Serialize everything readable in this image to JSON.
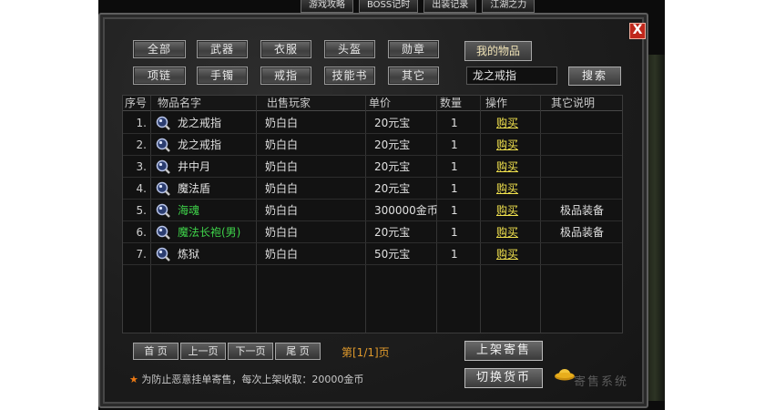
{
  "top_tabs": [
    "游戏攻略",
    "BOSS记时",
    "出装记录",
    "江湖之力"
  ],
  "close_label": "X",
  "categories_row1": [
    "全部",
    "武器",
    "衣服",
    "头盔",
    "勋章"
  ],
  "categories_row2": [
    "项链",
    "手镯",
    "戒指",
    "技能书",
    "其它"
  ],
  "my_items_label": "我的物品",
  "search": {
    "value": "龙之戒指",
    "button": "搜索"
  },
  "table": {
    "columns": [
      "序号",
      "物品名字",
      "出售玩家",
      "单价",
      "数量",
      "操作",
      "其它说明"
    ],
    "rows": [
      {
        "no": "1.",
        "name": "龙之戒指",
        "seller": "奶白白",
        "price": "20元宝",
        "qty": "1",
        "action": "购买",
        "note": "",
        "color": "#e0e0e0"
      },
      {
        "no": "2.",
        "name": "龙之戒指",
        "seller": "奶白白",
        "price": "20元宝",
        "qty": "1",
        "action": "购买",
        "note": "",
        "color": "#e0e0e0"
      },
      {
        "no": "3.",
        "name": "井中月",
        "seller": "奶白白",
        "price": "20元宝",
        "qty": "1",
        "action": "购买",
        "note": "",
        "color": "#e0e0e0"
      },
      {
        "no": "4.",
        "name": "魔法盾",
        "seller": "奶白白",
        "price": "20元宝",
        "qty": "1",
        "action": "购买",
        "note": "",
        "color": "#e0e0e0"
      },
      {
        "no": "5.",
        "name": "海魂",
        "seller": "奶白白",
        "price": "300000金币",
        "qty": "1",
        "action": "购买",
        "note": "极品装备",
        "color": "#3fd34a"
      },
      {
        "no": "6.",
        "name": "魔法长袍(男)",
        "seller": "奶白白",
        "price": "20元宝",
        "qty": "1",
        "action": "购买",
        "note": "极品装备",
        "color": "#3fd34a"
      },
      {
        "no": "7.",
        "name": "炼狱",
        "seller": "奶白白",
        "price": "50元宝",
        "qty": "1",
        "action": "购买",
        "note": "",
        "color": "#e0e0e0"
      }
    ]
  },
  "pager": {
    "first": "首 页",
    "prev": "上一页",
    "next": "下一页",
    "last": "尾 页",
    "info": "第[1/1]页"
  },
  "list_button": "上架寄售",
  "switch_currency_button": "切换货币",
  "notice": "为防止恶意挂单寄售，每次上架收取：20000金币",
  "watermark": "寄售系统",
  "icons": {
    "row_item": "magnifier-icon",
    "notice": "star-icon",
    "currency": "gold-ingot-icon",
    "close": "close-icon"
  }
}
